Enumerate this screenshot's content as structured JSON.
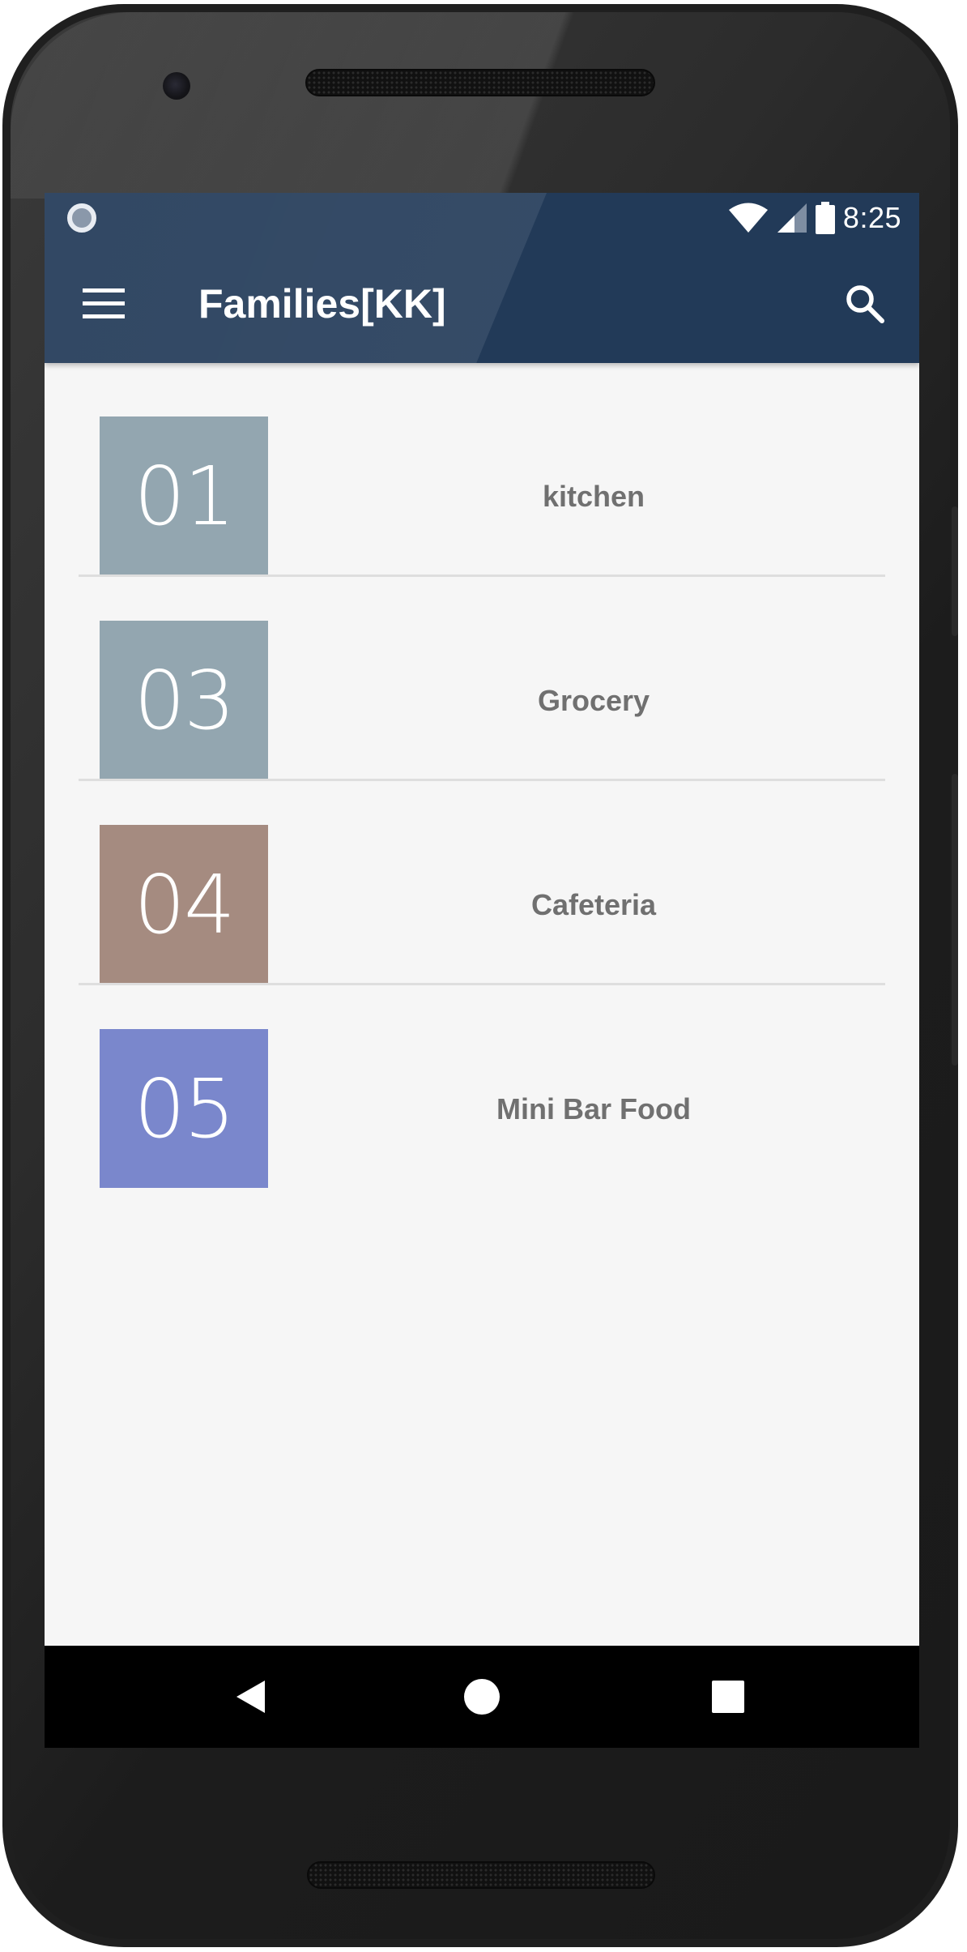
{
  "status_bar": {
    "time": "8:25",
    "icons": [
      "notification-dot-icon",
      "wifi-icon",
      "cellular-signal-icon",
      "battery-icon"
    ]
  },
  "toolbar": {
    "title": "Families[KK]",
    "menu_icon": "hamburger-menu-icon",
    "search_icon": "search-icon",
    "background_color": "#223a58"
  },
  "families": [
    {
      "code": "01",
      "name": "kitchen",
      "color": "#93a6b0"
    },
    {
      "code": "03",
      "name": "Grocery",
      "color": "#93a6b0"
    },
    {
      "code": "04",
      "name": "Cafeteria",
      "color": "#a58b80"
    },
    {
      "code": "05",
      "name": "Mini Bar Food",
      "color": "#7a87cc"
    }
  ],
  "navigation_bar": {
    "icons": [
      "back-icon",
      "home-icon",
      "recents-icon"
    ]
  }
}
